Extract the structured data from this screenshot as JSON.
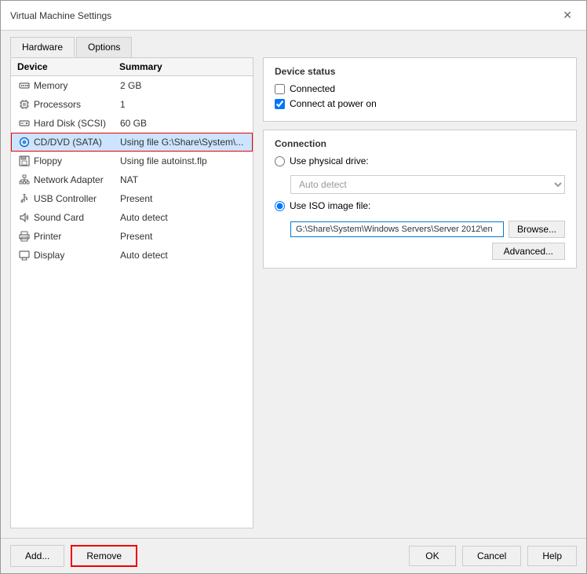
{
  "window": {
    "title": "Virtual Machine Settings",
    "close_label": "✕"
  },
  "tabs": [
    {
      "id": "hardware",
      "label": "Hardware",
      "active": true
    },
    {
      "id": "options",
      "label": "Options",
      "active": false
    }
  ],
  "device_table": {
    "col_device": "Device",
    "col_summary": "Summary",
    "devices": [
      {
        "id": "memory",
        "name": "Memory",
        "summary": "2 GB",
        "icon": "memory-icon",
        "selected": false
      },
      {
        "id": "processors",
        "name": "Processors",
        "summary": "1",
        "icon": "processor-icon",
        "selected": false
      },
      {
        "id": "hard-disk",
        "name": "Hard Disk (SCSI)",
        "summary": "60 GB",
        "icon": "disk-icon",
        "selected": false
      },
      {
        "id": "cddvd",
        "name": "CD/DVD (SATA)",
        "summary": "Using file G:\\Share\\System\\...",
        "icon": "cd-icon",
        "selected": true
      },
      {
        "id": "floppy",
        "name": "Floppy",
        "summary": "Using file autoinst.flp",
        "icon": "floppy-icon",
        "selected": false
      },
      {
        "id": "network",
        "name": "Network Adapter",
        "summary": "NAT",
        "icon": "network-icon",
        "selected": false
      },
      {
        "id": "usb",
        "name": "USB Controller",
        "summary": "Present",
        "icon": "usb-icon",
        "selected": false
      },
      {
        "id": "sound",
        "name": "Sound Card",
        "summary": "Auto detect",
        "icon": "sound-icon",
        "selected": false
      },
      {
        "id": "printer",
        "name": "Printer",
        "summary": "Present",
        "icon": "printer-icon",
        "selected": false
      },
      {
        "id": "display",
        "name": "Display",
        "summary": "Auto detect",
        "icon": "display-icon",
        "selected": false
      }
    ]
  },
  "device_status": {
    "section_title": "Device status",
    "connected_label": "Connected",
    "connect_at_power_on_label": "Connect at power on",
    "connected_checked": false,
    "connect_at_power_on_checked": true
  },
  "connection": {
    "section_title": "Connection",
    "use_physical_drive_label": "Use physical drive:",
    "auto_detect_label": "Auto detect",
    "use_iso_label": "Use ISO image file:",
    "iso_path": "G:\\Share\\System\\Windows Servers\\Server 2012\\en",
    "browse_label": "Browse...",
    "advanced_label": "Advanced..."
  },
  "bottom_buttons": {
    "add_label": "Add...",
    "remove_label": "Remove",
    "ok_label": "OK",
    "cancel_label": "Cancel",
    "help_label": "Help"
  }
}
